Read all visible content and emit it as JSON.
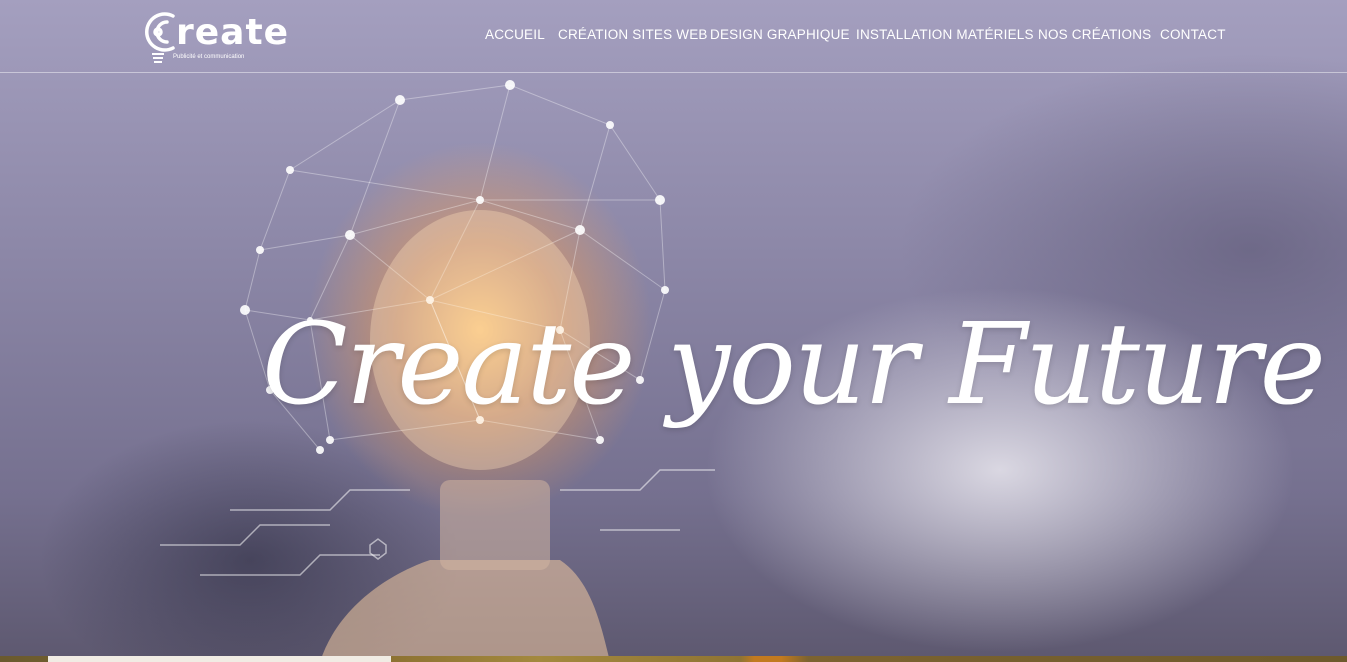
{
  "brand": {
    "logo_text": "reate",
    "tagline": "Publicité et communication"
  },
  "nav": {
    "items": [
      {
        "label": "ACCUEIL"
      },
      {
        "label": "CRÉATION SITES WEB"
      },
      {
        "label": "DESIGN GRAPHIQUE"
      },
      {
        "label": "INSTALLATION MATÉRIELS"
      },
      {
        "label": "NOS CRÉATIONS"
      },
      {
        "label": "CONTACT"
      }
    ]
  },
  "hero": {
    "headline": "Create your Future"
  },
  "colors": {
    "text": "#ffffff",
    "glow": "#f7a050",
    "overlay": "#8b86a6"
  },
  "icons": [
    "lightbulb-logo-icon"
  ]
}
